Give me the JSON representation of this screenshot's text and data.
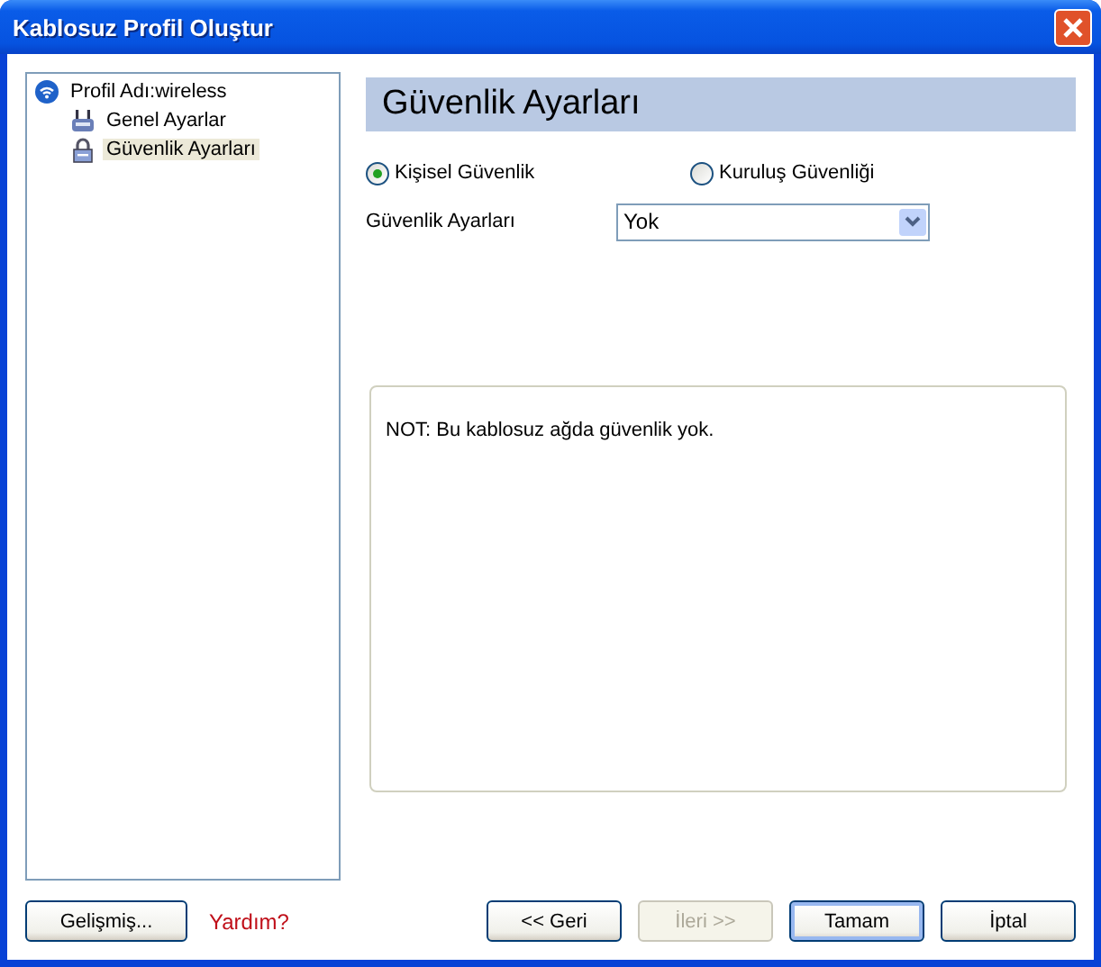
{
  "window": {
    "title": "Kablosuz Profil Oluştur"
  },
  "tree": [
    {
      "label": "Profil Adı:wireless",
      "selected": false,
      "children": [
        {
          "label": "Genel Ayarlar",
          "selected": false
        },
        {
          "label": "Güvenlik Ayarları",
          "selected": true
        }
      ]
    }
  ],
  "header": "Güvenlik Ayarları",
  "radios": [
    {
      "label": "Kişisel Güvenlik",
      "selected": true
    },
    {
      "label": "Kuruluş Güvenliği",
      "selected": false
    }
  ],
  "security_setting": {
    "label": "Güvenlik Ayarları",
    "value": "Yok"
  },
  "note": "NOT: Bu kablosuz ağda güvenlik yok.",
  "left_buttons": [
    {
      "label": "Gelişmiş...",
      "disabled": false,
      "default": false
    }
  ],
  "help_link": "Yardım?",
  "buttons": [
    {
      "label": "<< Geri",
      "disabled": false,
      "default": false
    },
    {
      "label": "İleri >>",
      "disabled": true,
      "default": false
    },
    {
      "label": "Tamam",
      "disabled": false,
      "default": true
    },
    {
      "label": "İptal",
      "disabled": false,
      "default": false
    }
  ]
}
